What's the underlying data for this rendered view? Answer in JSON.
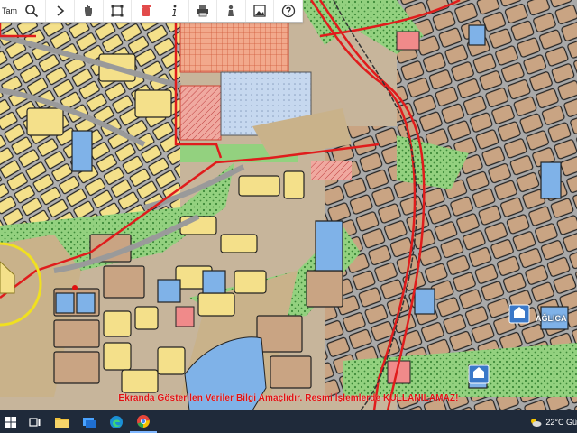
{
  "toolbar": {
    "label": "Tam",
    "tools": [
      {
        "name": "search-icon"
      },
      {
        "name": "arrow-icon"
      },
      {
        "name": "pan-hand-icon"
      },
      {
        "name": "fullscreen-icon"
      },
      {
        "name": "delete-icon"
      },
      {
        "name": "info-icon"
      },
      {
        "name": "print-icon"
      },
      {
        "name": "person-icon"
      },
      {
        "name": "image-icon"
      },
      {
        "name": "help-icon"
      }
    ]
  },
  "map": {
    "place_label": "AĞLICA",
    "disclaimer": "Ekranda Gösterilen Veriler Bilgi Amaçlıdır. Resmi İşlemlerde KULLANILAMAZ!"
  },
  "taskbar": {
    "apps": [
      {
        "name": "start-icon"
      },
      {
        "name": "task-view-icon"
      },
      {
        "name": "file-explorer-icon"
      },
      {
        "name": "app-icon"
      },
      {
        "name": "edge-icon"
      },
      {
        "name": "chrome-icon"
      }
    ],
    "weather": "22°C Gü"
  },
  "colors": {
    "residential": "#f4e08a",
    "commercial_red": "#f08a8a",
    "public_blue": "#7fb2e8",
    "green": "#8fce7a",
    "parcel": "#c9a483",
    "road_red": "#e01c1c"
  }
}
